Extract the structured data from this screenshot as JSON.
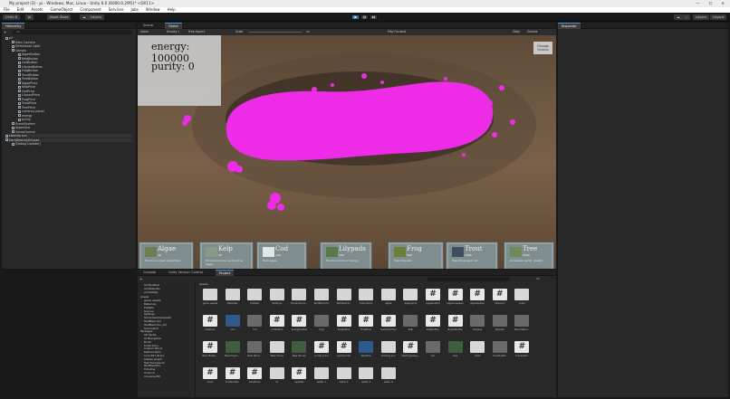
{
  "titlebar": {
    "title": "My project (3) - pi - Windows, Mac, Linux - Unity 6.0 (6000.0.29f1)* <DX11>",
    "minimize": "—",
    "maximize": "☐",
    "close": "✕"
  },
  "menubar": [
    "File",
    "Edit",
    "Assets",
    "GameObject",
    "Component",
    "Services",
    "Jobs",
    "Window",
    "Help"
  ],
  "toolbar": {
    "account": "Unity 6",
    "version_control": "pi",
    "asset_store": "Asset Store",
    "layers_label": "Layers",
    "layout_label": "Layout"
  },
  "hierarchy": {
    "tab": "Hierarchy",
    "search_placeholder": "All",
    "rows": [
      {
        "label": "pi*",
        "depth": 0
      },
      {
        "label": "Main Camera",
        "depth": 1
      },
      {
        "label": "Directional Light",
        "depth": 1
      },
      {
        "label": "Canvas",
        "depth": 1
      },
      {
        "label": "AlgaeButton",
        "depth": 2
      },
      {
        "label": "KelpButton",
        "depth": 2
      },
      {
        "label": "CodButton",
        "depth": 2
      },
      {
        "label": "LilypadButton",
        "depth": 2
      },
      {
        "label": "FrogButton",
        "depth": 2
      },
      {
        "label": "TroutButton",
        "depth": 2
      },
      {
        "label": "TreeButton",
        "depth": 2
      },
      {
        "label": "AlgaePrice",
        "depth": 2
      },
      {
        "label": "KelpPrice",
        "depth": 2
      },
      {
        "label": "CodPrice",
        "depth": 2
      },
      {
        "label": "LilypadPrice",
        "depth": 2
      },
      {
        "label": "FrogPrice",
        "depth": 2
      },
      {
        "label": "TroutPrice",
        "depth": 2
      },
      {
        "label": "TreePrice",
        "depth": 2
      },
      {
        "label": "currency panel",
        "depth": 2
      },
      {
        "label": "energy",
        "depth": 2
      },
      {
        "label": "purity",
        "depth": 2
      },
      {
        "label": "EventSystem",
        "depth": 1
      },
      {
        "label": "AlgaeSpw",
        "depth": 1
      },
      {
        "label": "GameControl",
        "depth": 1
      },
      {
        "label": "starting sun",
        "depth": 0
      },
      {
        "label": "DontDestroyOnLoad",
        "depth": 0
      },
      {
        "label": "[Debug Updater]",
        "depth": 1
      }
    ]
  },
  "scene_tabs": {
    "scene": "Scene",
    "game": "Game"
  },
  "game_toolbar": {
    "display": "Game",
    "display_number": "Display 1",
    "aspect": "Free Aspect",
    "scale_label": "Scale",
    "scale_value": "1x",
    "play_focused": "Play Focused",
    "stats": "Stats",
    "gizmos": "Gizmos"
  },
  "hud": {
    "energy_label": "energy:",
    "energy_value": "100000",
    "purity_label": "purity:",
    "purity_value": "0"
  },
  "change_season_button": "Change Season",
  "cards": [
    {
      "name": "Algae",
      "price": "20",
      "desc": "Produces small quantities"
    },
    {
      "name": "Kelp",
      "price": "50",
      "desc": "Produces twice as much as algae"
    },
    {
      "name": "Cod",
      "price": "100",
      "desc": "Eats algae"
    },
    {
      "name": "Lilypads",
      "price": "200",
      "desc": "Produces lots of energy"
    },
    {
      "name": "Frog",
      "price": "500",
      "desc": "Eats lilypads"
    },
    {
      "name": "Trout",
      "price": "1000",
      "desc": "Eats frogs and cod"
    },
    {
      "name": "Tree",
      "price": "2000",
      "desc": "Increases purity greatly"
    }
  ],
  "inspector": {
    "tab": "Inspector"
  },
  "bottom_tabs": {
    "console": "Console",
    "uvc": "Unity Version Control",
    "project": "Project"
  },
  "project": {
    "favorites": [
      "All Modified",
      "All Materials",
      "All Prefabs"
    ],
    "tree_assets": [
      "Assets",
      "game assets",
      "Materials",
      "Prefabs",
      "Scenes",
      "Settings",
      "TerrainSampleAssets",
      "TextMesh Pro",
      "TextMesh Pro_old",
      "TutorialInfo"
    ],
    "tree_packages": [
      "Packages",
      "2D Sprite",
      "AI Navigation",
      "Burst",
      "Collections",
      "Custom NUnit",
      "Mathematics",
      "Core RP Library",
      "Shader Graph",
      "Test Framework",
      "TextMeshPro",
      "Timeline",
      "Unity UI",
      "Universal RP"
    ],
    "breadcrumb": "Assets",
    "item_count": "22",
    "assets": [
      {
        "label": "game assets",
        "kind": "go"
      },
      {
        "label": "Materials",
        "kind": "go"
      },
      {
        "label": "Prefabs",
        "kind": "go"
      },
      {
        "label": "Settings",
        "kind": "go"
      },
      {
        "label": "TerrainSamp...",
        "kind": "go"
      },
      {
        "label": "TextMesh Pro",
        "kind": "go"
      },
      {
        "label": "TextMesh P...",
        "kind": "go"
      },
      {
        "label": "TutorialInfo",
        "kind": "go"
      },
      {
        "label": "algae",
        "kind": "mat"
      },
      {
        "label": "algaeprice",
        "kind": "mat"
      },
      {
        "label": "algaebutton",
        "kind": "cs"
      },
      {
        "label": "algaeonspawn",
        "kind": "cs"
      },
      {
        "label": "AlgaeSpawn",
        "kind": "cs"
      },
      {
        "label": "billboard",
        "kind": "cs"
      },
      {
        "label": "Cube",
        "kind": "mat"
      },
      {
        "label": "Creature",
        "kind": "cs"
      },
      {
        "label": "cod",
        "kind": "pref"
      },
      {
        "label": "cod",
        "kind": "mesh"
      },
      {
        "label": "codbutton",
        "kind": "cs"
      },
      {
        "label": "energybutton",
        "kind": "cs"
      },
      {
        "label": "frog",
        "kind": "mesh"
      },
      {
        "label": "frogbutton",
        "kind": "cs"
      },
      {
        "label": "FrogPrice",
        "kind": "cs"
      },
      {
        "label": "GameControl",
        "kind": "cs"
      },
      {
        "label": "kelp",
        "kind": "mesh"
      },
      {
        "label": "kelpbutton",
        "kind": "cs"
      },
      {
        "label": "lilypadbutton",
        "kind": "cs"
      },
      {
        "label": "lilypads",
        "kind": "mesh"
      },
      {
        "label": "lilypads",
        "kind": "mesh"
      },
      {
        "label": "New Materi...",
        "kind": "mesh"
      },
      {
        "label": "New Materi...",
        "kind": "cs"
      },
      {
        "label": "New Physic...",
        "kind": "tex"
      },
      {
        "label": "New Rend...",
        "kind": "mesh"
      },
      {
        "label": "New Scene",
        "kind": "go"
      },
      {
        "label": "New Terrain",
        "kind": "tex"
      },
      {
        "label": "purity price",
        "kind": "cs"
      },
      {
        "label": "purityscript",
        "kind": "cs"
      },
      {
        "label": "Readme",
        "kind": "pref"
      },
      {
        "label": "starting sun",
        "kind": "go"
      },
      {
        "label": "startingenerg...",
        "kind": "cs"
      },
      {
        "label": "sun",
        "kind": "mesh"
      },
      {
        "label": "tree",
        "kind": "tex"
      },
      {
        "label": "trout",
        "kind": "mat"
      },
      {
        "label": "troutbutton",
        "kind": "mesh"
      },
      {
        "label": "treebutton",
        "kind": "cs"
      },
      {
        "label": "trout",
        "kind": "cs"
      },
      {
        "label": "troutbutton",
        "kind": "cs"
      },
      {
        "label": "troutPrice",
        "kind": "cs"
      },
      {
        "label": "UI",
        "kind": "go"
      },
      {
        "label": "updater",
        "kind": "cs"
      },
      {
        "label": "water 1",
        "kind": "go"
      },
      {
        "label": "water 2",
        "kind": "go"
      },
      {
        "label": "water 3",
        "kind": "go"
      },
      {
        "label": "water 4",
        "kind": "go"
      }
    ]
  }
}
